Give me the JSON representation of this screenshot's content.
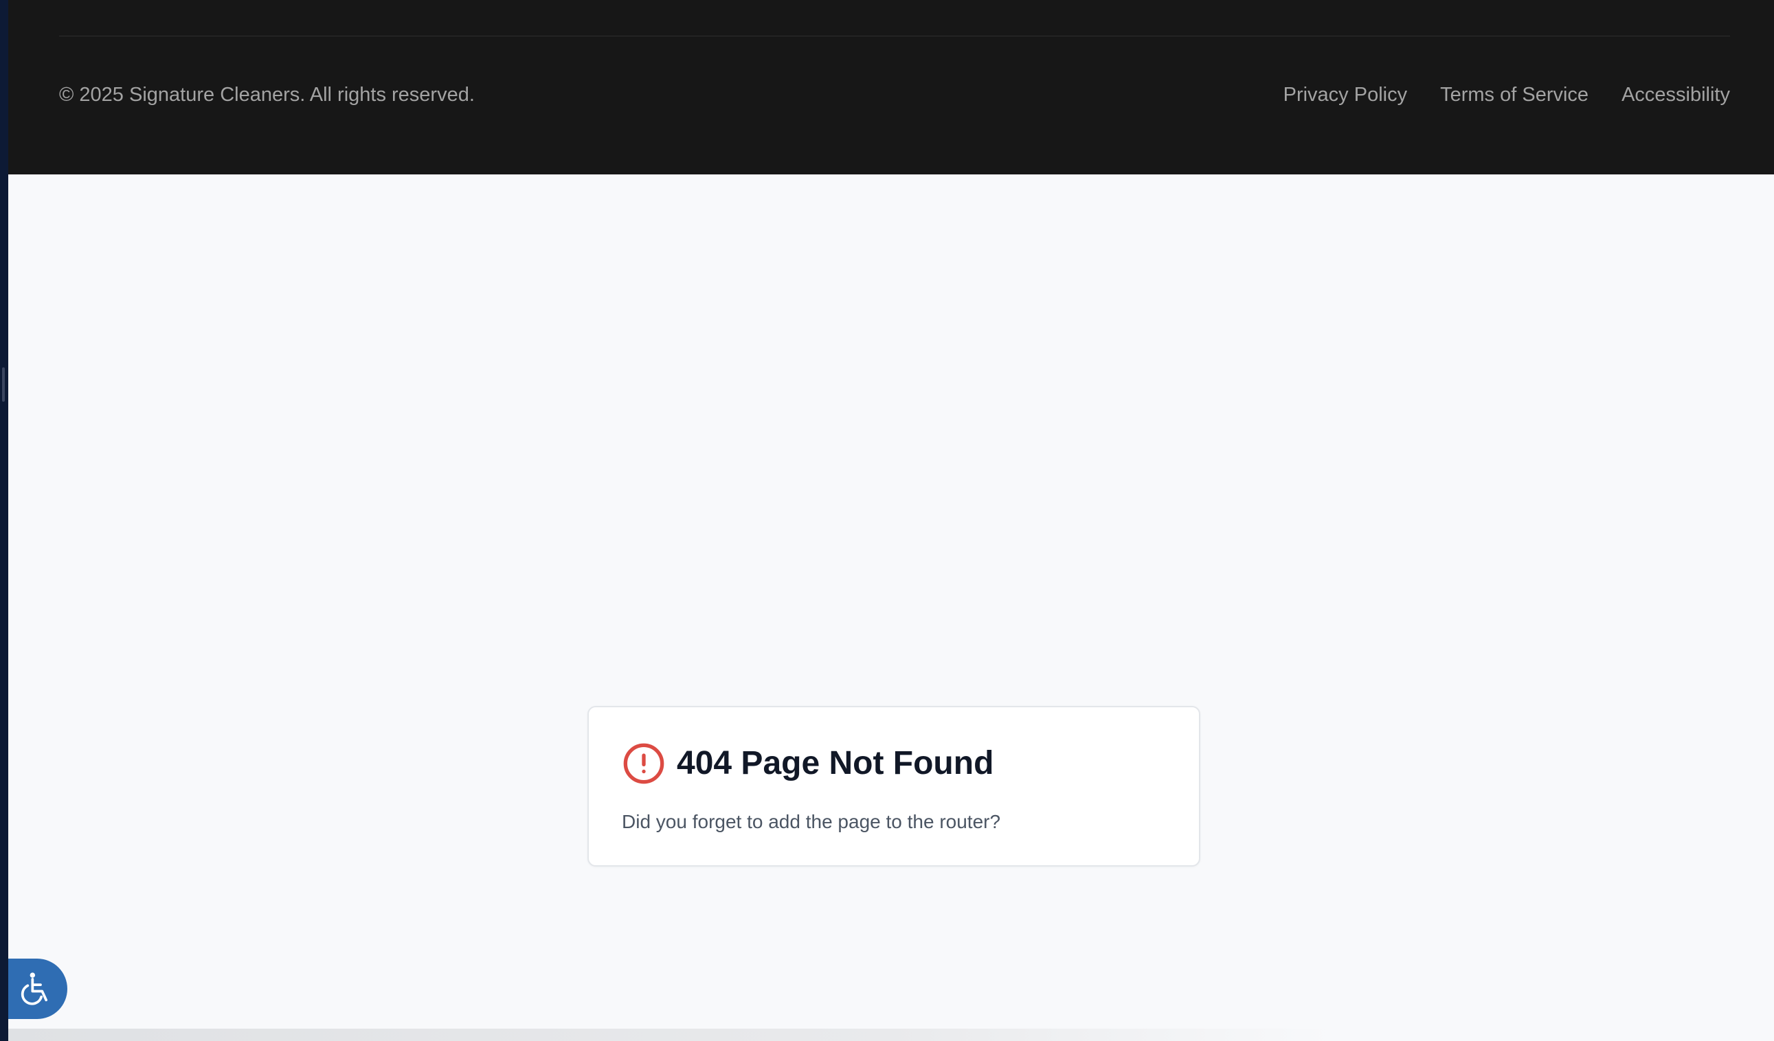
{
  "footer": {
    "copyright": "© 2025 Signature Cleaners. All rights reserved.",
    "links": [
      {
        "label": "Privacy Policy"
      },
      {
        "label": "Terms of Service"
      },
      {
        "label": "Accessibility"
      }
    ]
  },
  "not_found": {
    "title": "404 Page Not Found",
    "message": "Did you forget to add the page to the router?",
    "icon": "alert-circle-icon"
  },
  "accessibility_widget": {
    "icon": "wheelchair-icon"
  },
  "colors": {
    "footer_background": "#171717",
    "page_background": "#f8f9fb",
    "alert_red": "#dc4b43",
    "accessibility_blue": "#2f6db3",
    "title_text": "#111827"
  }
}
